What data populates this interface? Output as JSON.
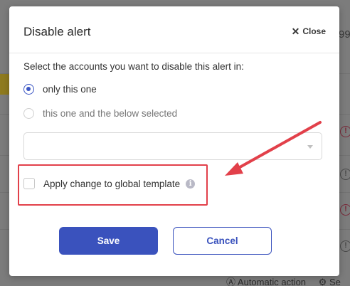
{
  "background": {
    "top_text": "99",
    "footer_action": "Automatic action",
    "footer_settings": "Se",
    "status_glyph": "!"
  },
  "modal": {
    "title": "Disable alert",
    "close_label": "Close",
    "close_glyph": "✕",
    "prompt": "Select the accounts you want to disable this alert in:",
    "options": [
      {
        "label": "only this one",
        "checked": true
      },
      {
        "label": "this one and the below selected",
        "checked": false
      }
    ],
    "account_select": {
      "value": ""
    },
    "global_template": {
      "label": "Apply change to global template",
      "checked": false,
      "info_glyph": "i"
    },
    "save_label": "Save",
    "cancel_label": "Cancel"
  },
  "colors": {
    "primary": "#3a52bd",
    "annotation": "#e2404a"
  }
}
